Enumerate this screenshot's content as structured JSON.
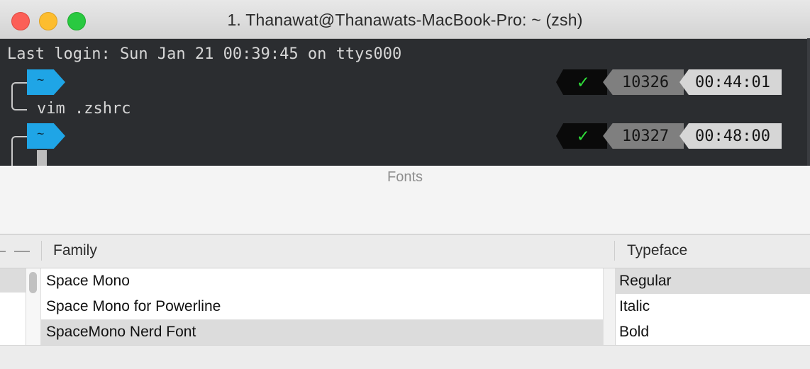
{
  "window": {
    "title": "1. Thanawat@Thanawats-MacBook-Pro: ~ (zsh)"
  },
  "terminal": {
    "last_login": "Last login: Sun Jan 21 00:39:45 on ttys000",
    "prompt_symbol": "~",
    "command_1": "vim .zshrc",
    "status_1": {
      "ok": "✓",
      "history": "10326",
      "time": "00:44:01"
    },
    "status_2": {
      "ok": "✓",
      "history": "10327",
      "time": "00:48:00"
    },
    "colors": {
      "prompt_bg": "#1fa5e6",
      "ok_green": "#2fe03a"
    }
  },
  "fonts_panel": {
    "title": "Fonts",
    "columns": {
      "family": "Family",
      "typeface": "Typeface"
    },
    "families": [
      {
        "name": "Space Mono",
        "selected": false
      },
      {
        "name": "Space Mono for Powerline",
        "selected": false
      },
      {
        "name": "SpaceMono Nerd Font",
        "selected": true
      }
    ],
    "typefaces": [
      {
        "name": "Regular",
        "selected": true
      },
      {
        "name": "Italic",
        "selected": false
      },
      {
        "name": "Bold",
        "selected": false
      }
    ]
  }
}
